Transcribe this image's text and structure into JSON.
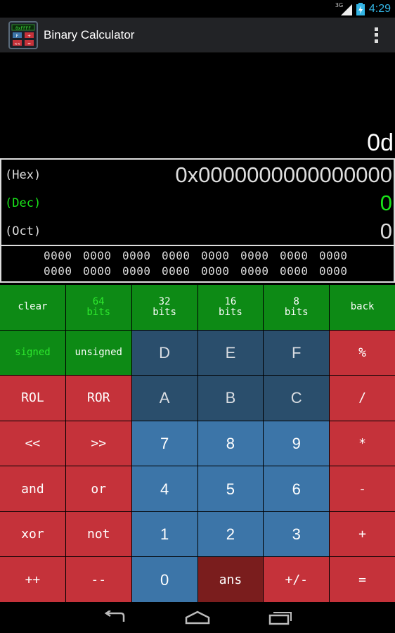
{
  "status_bar": {
    "network": "3G",
    "time": "4:29"
  },
  "app": {
    "title": "Binary Calculator",
    "icon_text": "0xFFFF",
    "icon_keys": [
      "F",
      "+",
      "<<",
      "="
    ]
  },
  "display": {
    "main_value": "0d",
    "radix": [
      {
        "label": "(Hex)",
        "value": "0x0000000000000000",
        "active": false
      },
      {
        "label": "(Dec)",
        "value": "0",
        "active": true
      },
      {
        "label": "(Oct)",
        "value": "0",
        "active": false
      }
    ],
    "bits_row1": [
      "0000",
      "0000",
      "0000",
      "0000",
      "0000",
      "0000",
      "0000",
      "0000"
    ],
    "bits_row2": [
      "0000",
      "0000",
      "0000",
      "0000",
      "0000",
      "0000",
      "0000",
      "0000"
    ]
  },
  "keypad": {
    "clear": "clear",
    "bits64": [
      "64",
      "bits"
    ],
    "bits32": [
      "32",
      "bits"
    ],
    "bits16": [
      "16",
      "bits"
    ],
    "bits8": [
      "8",
      "bits"
    ],
    "back": "back",
    "signed": "signed",
    "unsigned": "unsigned",
    "D": "D",
    "E": "E",
    "F": "F",
    "mod": "%",
    "rol": "ROL",
    "ror": "ROR",
    "A": "A",
    "B": "B",
    "C": "C",
    "div": "/",
    "shl": "<<",
    "shr": ">>",
    "n7": "7",
    "n8": "8",
    "n9": "9",
    "mul": "*",
    "and": "and",
    "or": "or",
    "n4": "4",
    "n5": "5",
    "n6": "6",
    "sub": "-",
    "xor": "xor",
    "not": "not",
    "n1": "1",
    "n2": "2",
    "n3": "3",
    "add": "+",
    "inc": "++",
    "dec": "--",
    "n0": "0",
    "ans": "ans",
    "neg": "+/-",
    "eq": "="
  },
  "colors": {
    "green_key": "#0d8a15",
    "red_key": "#c5323a",
    "hex_key": "#2a4e6c",
    "digit_key": "#3c75a8",
    "ans_key": "#7a1d1d",
    "active_text": "#19e319"
  },
  "nav": {
    "icons": [
      "back-icon",
      "home-icon",
      "recents-icon"
    ]
  }
}
